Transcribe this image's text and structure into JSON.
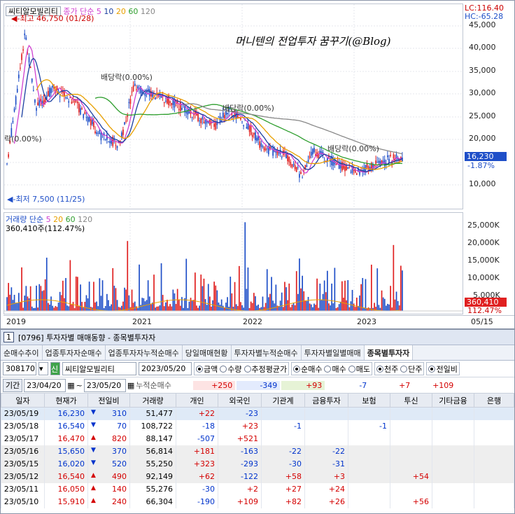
{
  "chart": {
    "stock_name_box": "씨티알모빌리티",
    "ma_legend": {
      "label": "종가 단순",
      "ma5": "5",
      "ma10": "10",
      "ma20": "20",
      "ma60": "60",
      "ma120": "120"
    },
    "lc": "LC:116.40",
    "hc": "HC:-65.28",
    "watermark": "머니텐의 전업투자 꿈꾸기(@Blog)",
    "high_label": "최고 46,750 (01/28)",
    "low_label": "최저 7,500 (11/25)",
    "dividend_labels": [
      "배당락(0.00%)",
      "배당락(0.00%)",
      "배당락(0.00%)",
      "락(0.00%)"
    ],
    "price_axis": [
      "45,000",
      "40,000",
      "35,000",
      "30,000",
      "25,000",
      "20,000",
      "15,000",
      "10,000"
    ],
    "current_price_tag": "16,230",
    "current_change_tag": "-1.87%",
    "volume_legend": {
      "label": "거래량 단순",
      "ma5": "5",
      "ma20": "20",
      "ma60": "60",
      "ma120": "120"
    },
    "volume_current": "360,410주(112.47%)",
    "volume_axis": [
      "25,000K",
      "20,000K",
      "15,000K",
      "10,000K",
      "5,000K"
    ],
    "volume_tag": "360,410",
    "volume_pct_tag": "112.47%",
    "x_axis": [
      "2019",
      "2021",
      "2022",
      "2023",
      "05/15"
    ],
    "colors": {
      "up": "#e02020",
      "down": "#1f4fc8",
      "ma5": "#d040d0",
      "ma10": "#1a3fa0",
      "ma20": "#e8a000",
      "ma60": "#2e9e2e",
      "ma120": "#888888"
    }
  },
  "panel": {
    "screen_no": "1",
    "title": "[0796] 투자자별 매매동향 - 종목별투자자",
    "tabs": [
      "순매수추이",
      "업종투자자순매수",
      "업종투자자누적순매수",
      "당일매매현황",
      "투자자별누적순매수",
      "투자자별일별매매",
      "종목별투자자"
    ],
    "code": "308170",
    "new_badge": "신",
    "name": "씨티알모빌리티",
    "date": "2023/05/20",
    "radio_amount": [
      "금액",
      "수량",
      "추정평균가"
    ],
    "radio_trade": [
      "순매수",
      "매수",
      "매도"
    ],
    "radio_unit": [
      "천주",
      "단주"
    ],
    "radio_prev": "전일비",
    "period_label": "기간",
    "date_from": "23/04/20",
    "date_to": "23/05/20",
    "cumulative_label": "누적순매수",
    "cumulative": [
      "+250",
      "-349",
      "+93",
      "-7",
      "+7",
      "+109"
    ],
    "headers": [
      "일자",
      "현재가",
      "전일비",
      "거래량",
      "개인",
      "외국인",
      "기관계",
      "금융투자",
      "보험",
      "투신",
      "기타금융",
      "은행"
    ],
    "rows": [
      {
        "date": "23/05/19",
        "price": "16,230",
        "dir": "down",
        "chg": "310",
        "vol": "51,477",
        "ind": "+22",
        "frg": "-23",
        "inst": "",
        "fin": "",
        "ins": "",
        "trust": "",
        "etc": "",
        "bank": ""
      },
      {
        "date": "23/05/18",
        "price": "16,540",
        "dir": "down",
        "chg": "70",
        "vol": "108,722",
        "ind": "-18",
        "frg": "+23",
        "inst": "-1",
        "fin": "",
        "ins": "-1",
        "trust": "",
        "etc": "",
        "bank": ""
      },
      {
        "date": "23/05/17",
        "price": "16,470",
        "dir": "up",
        "chg": "820",
        "vol": "88,147",
        "ind": "-507",
        "frg": "+521",
        "inst": "",
        "fin": "",
        "ins": "",
        "trust": "",
        "etc": "",
        "bank": ""
      },
      {
        "date": "23/05/16",
        "price": "15,650",
        "dir": "down",
        "chg": "370",
        "vol": "56,814",
        "ind": "+181",
        "frg": "-163",
        "inst": "-22",
        "fin": "-22",
        "ins": "",
        "trust": "",
        "etc": "",
        "bank": ""
      },
      {
        "date": "23/05/15",
        "price": "16,020",
        "dir": "down",
        "chg": "520",
        "vol": "55,250",
        "ind": "+323",
        "frg": "-293",
        "inst": "-30",
        "fin": "-31",
        "ins": "",
        "trust": "",
        "etc": "",
        "bank": ""
      },
      {
        "date": "23/05/12",
        "price": "16,540",
        "dir": "up",
        "chg": "490",
        "vol": "92,149",
        "ind": "+62",
        "frg": "-122",
        "inst": "+58",
        "fin": "+3",
        "ins": "",
        "trust": "+54",
        "etc": "",
        "bank": ""
      },
      {
        "date": "23/05/11",
        "price": "16,050",
        "dir": "up",
        "chg": "140",
        "vol": "55,276",
        "ind": "-30",
        "frg": "+2",
        "inst": "+27",
        "fin": "+24",
        "ins": "",
        "trust": "",
        "etc": "",
        "bank": ""
      },
      {
        "date": "23/05/10",
        "price": "15,910",
        "dir": "up",
        "chg": "240",
        "vol": "66,304",
        "ind": "-190",
        "frg": "+109",
        "inst": "+82",
        "fin": "+26",
        "ins": "",
        "trust": "+56",
        "etc": "",
        "bank": ""
      }
    ]
  }
}
